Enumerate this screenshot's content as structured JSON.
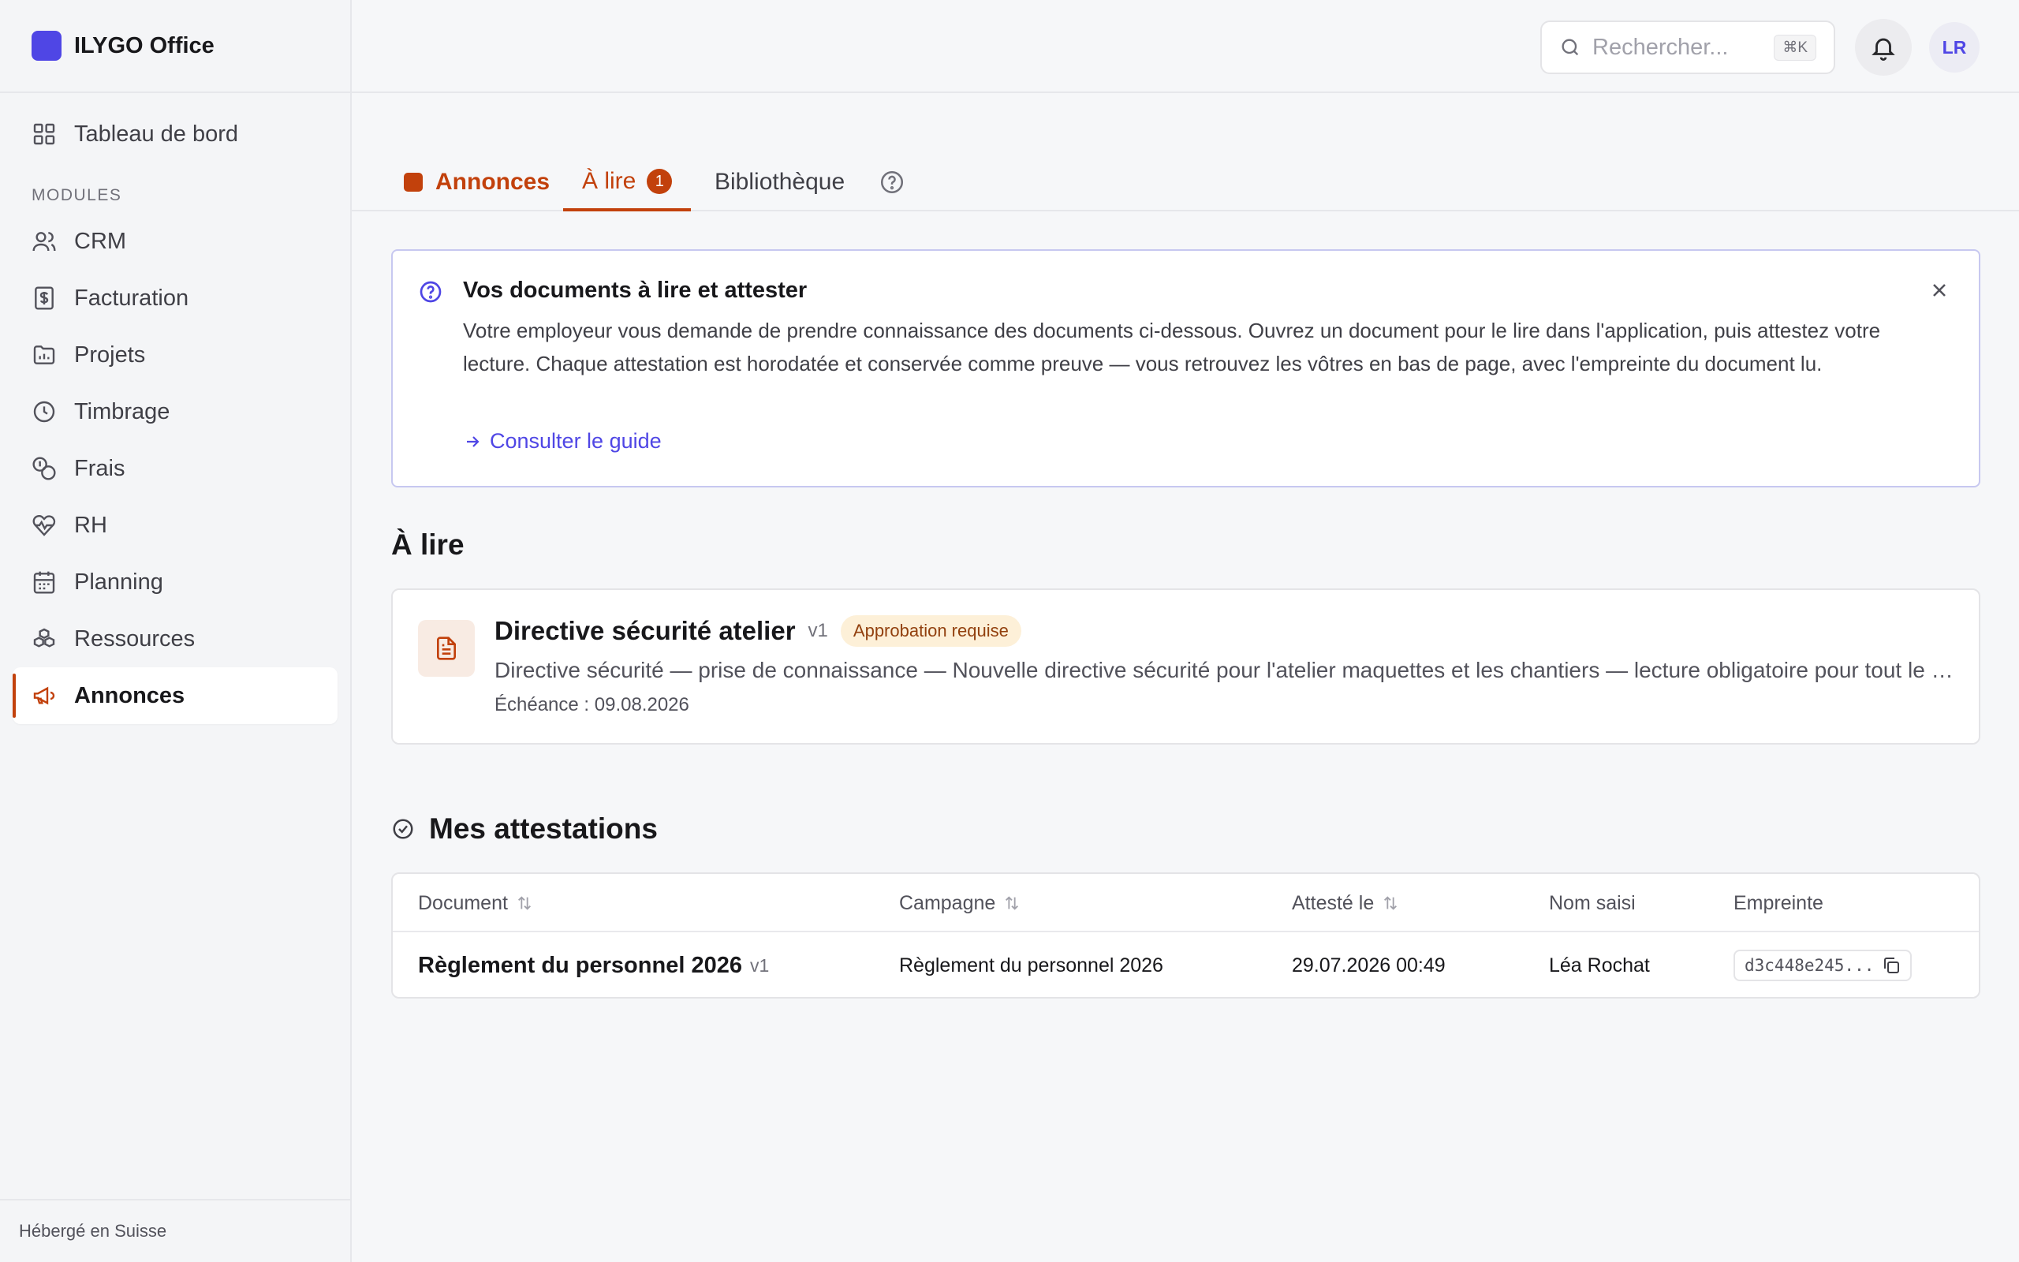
{
  "app": {
    "name": "ILYGO Office"
  },
  "sidebar": {
    "top_item": {
      "label": "Tableau de bord",
      "icon": "dashboard-icon"
    },
    "section_label": "MODULES",
    "items": [
      {
        "label": "CRM",
        "icon": "users-icon"
      },
      {
        "label": "Facturation",
        "icon": "invoice-icon"
      },
      {
        "label": "Projets",
        "icon": "folder-icon"
      },
      {
        "label": "Timbrage",
        "icon": "clock-icon"
      },
      {
        "label": "Frais",
        "icon": "coins-icon"
      },
      {
        "label": "RH",
        "icon": "heart-pulse-icon"
      },
      {
        "label": "Planning",
        "icon": "calendar-icon"
      },
      {
        "label": "Ressources",
        "icon": "boxes-icon"
      },
      {
        "label": "Annonces",
        "icon": "megaphone-icon",
        "active": true
      }
    ],
    "footer": "Hébergé en Suisse"
  },
  "topbar": {
    "search_placeholder": "Rechercher...",
    "shortcut": "⌘K",
    "avatar_initials": "LR"
  },
  "tabs": {
    "annonces": "Annonces",
    "a_lire": "À lire",
    "a_lire_count": "1",
    "bibliotheque": "Bibliothèque"
  },
  "info": {
    "title": "Vos documents à lire et attester",
    "body": "Votre employeur vous demande de prendre connaissance des documents ci-dessous. Ouvrez un document pour le lire dans l'application, puis attestez votre lecture. Chaque attestation est horodatée et conservée comme preuve — vous retrouvez les vôtres en bas de page, avec l'empreinte du document lu.",
    "link": "Consulter le guide"
  },
  "to_read": {
    "heading": "À lire",
    "document": {
      "title": "Directive sécurité atelier",
      "version": "v1",
      "badge": "Approbation requise",
      "description": "Directive sécurité — prise de connaissance — Nouvelle directive sécurité pour l'atelier maquettes et les chantiers — lecture obligatoire pour tout le personnel",
      "due": "Échéance : 09.08.2026"
    }
  },
  "attestations": {
    "heading": "Mes attestations",
    "columns": [
      "Document",
      "Campagne",
      "Attesté le",
      "Nom saisi",
      "Empreinte"
    ],
    "rows": [
      {
        "document": "Règlement du personnel 2026",
        "version": "v1",
        "campaign": "Règlement du personnel 2026",
        "date": "29.07.2026 00:49",
        "name": "Léa Rochat",
        "hash": "d3c448e245..."
      }
    ]
  },
  "colors": {
    "accent": "#c2410c",
    "brand": "#4f46e5"
  }
}
